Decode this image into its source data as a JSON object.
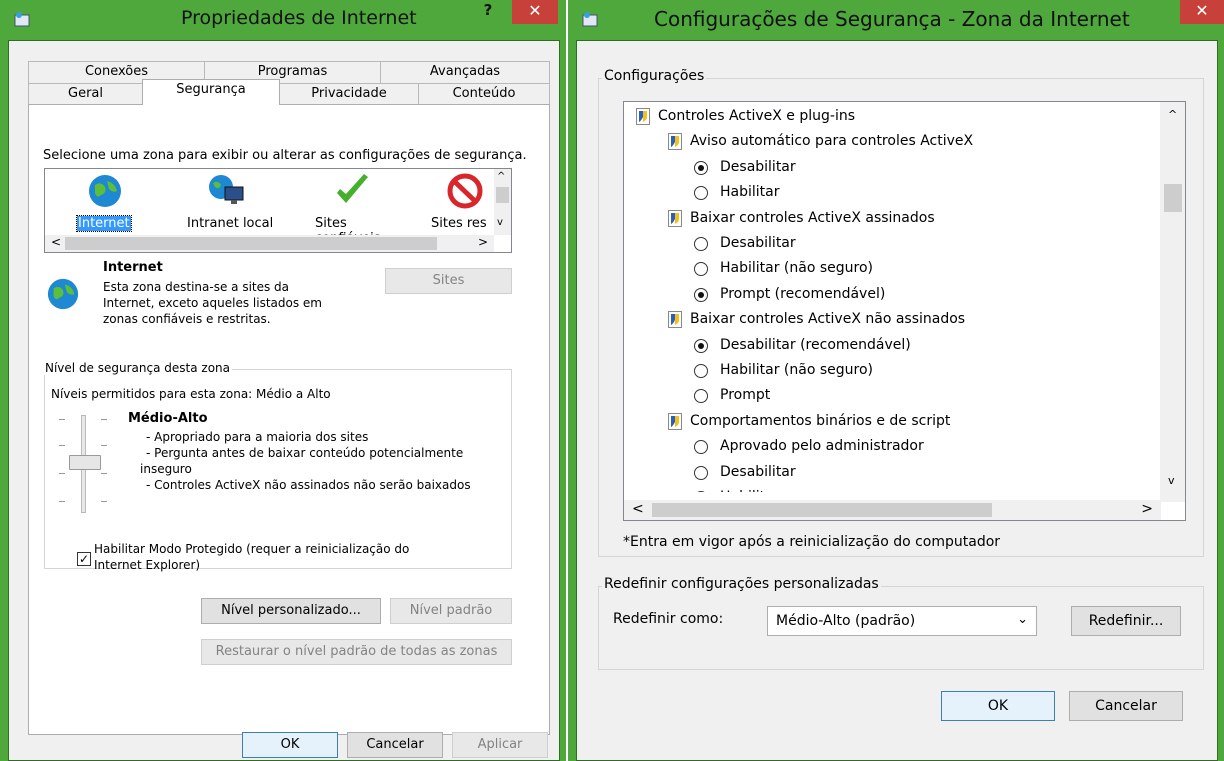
{
  "left_dialog": {
    "title": "Propriedades de Internet",
    "help": "?",
    "close": "✕",
    "tabs_top": [
      "Conexões",
      "Programas",
      "Avançadas"
    ],
    "tabs_bottom": [
      "Geral",
      "Segurança",
      "Privacidade",
      "Conteúdo"
    ],
    "zone_instructions": "Selecione uma zona para exibir ou alterar as configurações de segurança.",
    "zones": [
      "Internet",
      "Intranet local",
      "Sites confiáveis",
      "Sites res"
    ],
    "zone_title": "Internet",
    "zone_description": [
      "Esta zona destina-se a sites da",
      "Internet, exceto aqueles listados em",
      "zonas confiáveis e restritas."
    ],
    "sites_button": "Sites",
    "level_group_label": "Nível de segurança desta zona",
    "allowed_levels": "Níveis permitidos para esta zona: Médio a Alto",
    "level_name": "Médio-Alto",
    "level_bullets": [
      "- Apropriado para a maioria dos sites",
      "- Pergunta antes de baixar conteúdo potencialmente",
      "inseguro",
      "- Controles ActiveX não assinados não serão baixados"
    ],
    "protected_mode_checked": true,
    "protected_mode_label": [
      "Habilitar Modo Protegido (requer a reinicialização do",
      "Internet Explorer)"
    ],
    "custom_level_button": "Nível personalizado...",
    "default_level_button": "Nível padrão",
    "restore_all_button": "Restaurar o nível padrão de todas as zonas",
    "ok": "OK",
    "cancel": "Cancelar",
    "apply": "Aplicar"
  },
  "right_dialog": {
    "title": "Configurações de Segurança - Zona da Internet",
    "close": "✕",
    "settings_group_label": "Configurações",
    "tree": [
      {
        "kind": "category",
        "label": "Controles ActiveX e plug-ins"
      },
      {
        "kind": "setting",
        "label": "Aviso automático para controles ActiveX"
      },
      {
        "kind": "option",
        "label": "Desabilitar",
        "selected": true
      },
      {
        "kind": "option",
        "label": "Habilitar",
        "selected": false
      },
      {
        "kind": "setting",
        "label": "Baixar controles ActiveX assinados"
      },
      {
        "kind": "option",
        "label": "Desabilitar",
        "selected": false
      },
      {
        "kind": "option",
        "label": "Habilitar (não seguro)",
        "selected": false
      },
      {
        "kind": "option",
        "label": "Prompt (recomendável)",
        "selected": true
      },
      {
        "kind": "setting",
        "label": "Baixar controles ActiveX não assinados"
      },
      {
        "kind": "option",
        "label": "Desabilitar (recomendável)",
        "selected": true
      },
      {
        "kind": "option",
        "label": "Habilitar (não seguro)",
        "selected": false
      },
      {
        "kind": "option",
        "label": "Prompt",
        "selected": false
      },
      {
        "kind": "setting",
        "label": "Comportamentos binários e de script"
      },
      {
        "kind": "option",
        "label": "Aprovado pelo administrador",
        "selected": false
      },
      {
        "kind": "option",
        "label": "Desabilitar",
        "selected": false
      },
      {
        "kind": "option",
        "label": "Habilitar",
        "selected": true
      }
    ],
    "restart_note": "*Entra em vigor após a reinicialização do computador",
    "reset_group_label": "Redefinir configurações personalizadas",
    "reset_to_label": "Redefinir como:",
    "reset_select_value": "Médio-Alto (padrão)",
    "reset_button": "Redefinir...",
    "ok": "OK",
    "cancel": "Cancelar"
  },
  "colors": {
    "titlebar_green": "#4ea83c",
    "close_red": "#c7403a",
    "selection_blue": "#3399ff"
  }
}
